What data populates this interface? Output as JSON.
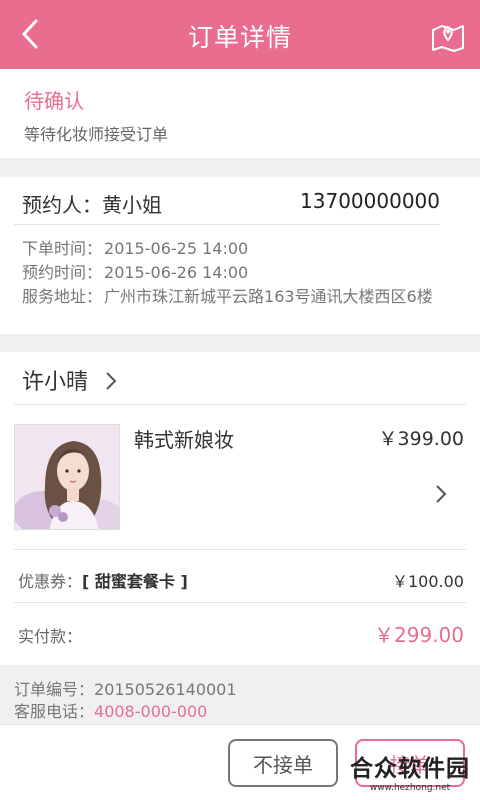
{
  "header": {
    "title": "订单详情",
    "back_icon": "back-arrow-icon",
    "map_icon": "map-icon",
    "color": "#e96d8f"
  },
  "status": {
    "title": "待确认",
    "desc": "等待化妆师接受订单"
  },
  "booking": {
    "booker_label": "预约人：黄小姐",
    "phone": "13700000000",
    "order_time_label": "下单时间：",
    "order_time": "2015-06-25 14:00",
    "appointment_time_label": "预约时间：",
    "appointment_time": "2015-06-26 14:00",
    "address_label": "服务地址：",
    "address": "广州市珠江新城平云路163号通讯大楼西区6楼"
  },
  "artist": {
    "name": "许小晴"
  },
  "product": {
    "name": "韩式新娘妆",
    "price": "￥399.00"
  },
  "coupon": {
    "label": "优惠券：",
    "name": "[ 甜蜜套餐卡 ]",
    "amount": "￥100.00"
  },
  "payment": {
    "label": "实付款：",
    "amount": "￥299.00"
  },
  "order_meta": {
    "number_label": "订单编号：",
    "number": "20150526140001",
    "service_label": "客服电话：",
    "service_phone": "4008-000-000"
  },
  "actions": {
    "reject": "不接单",
    "accept": "接单"
  },
  "watermark": {
    "text": "合众软件园",
    "url": "www.hezhong.net"
  }
}
